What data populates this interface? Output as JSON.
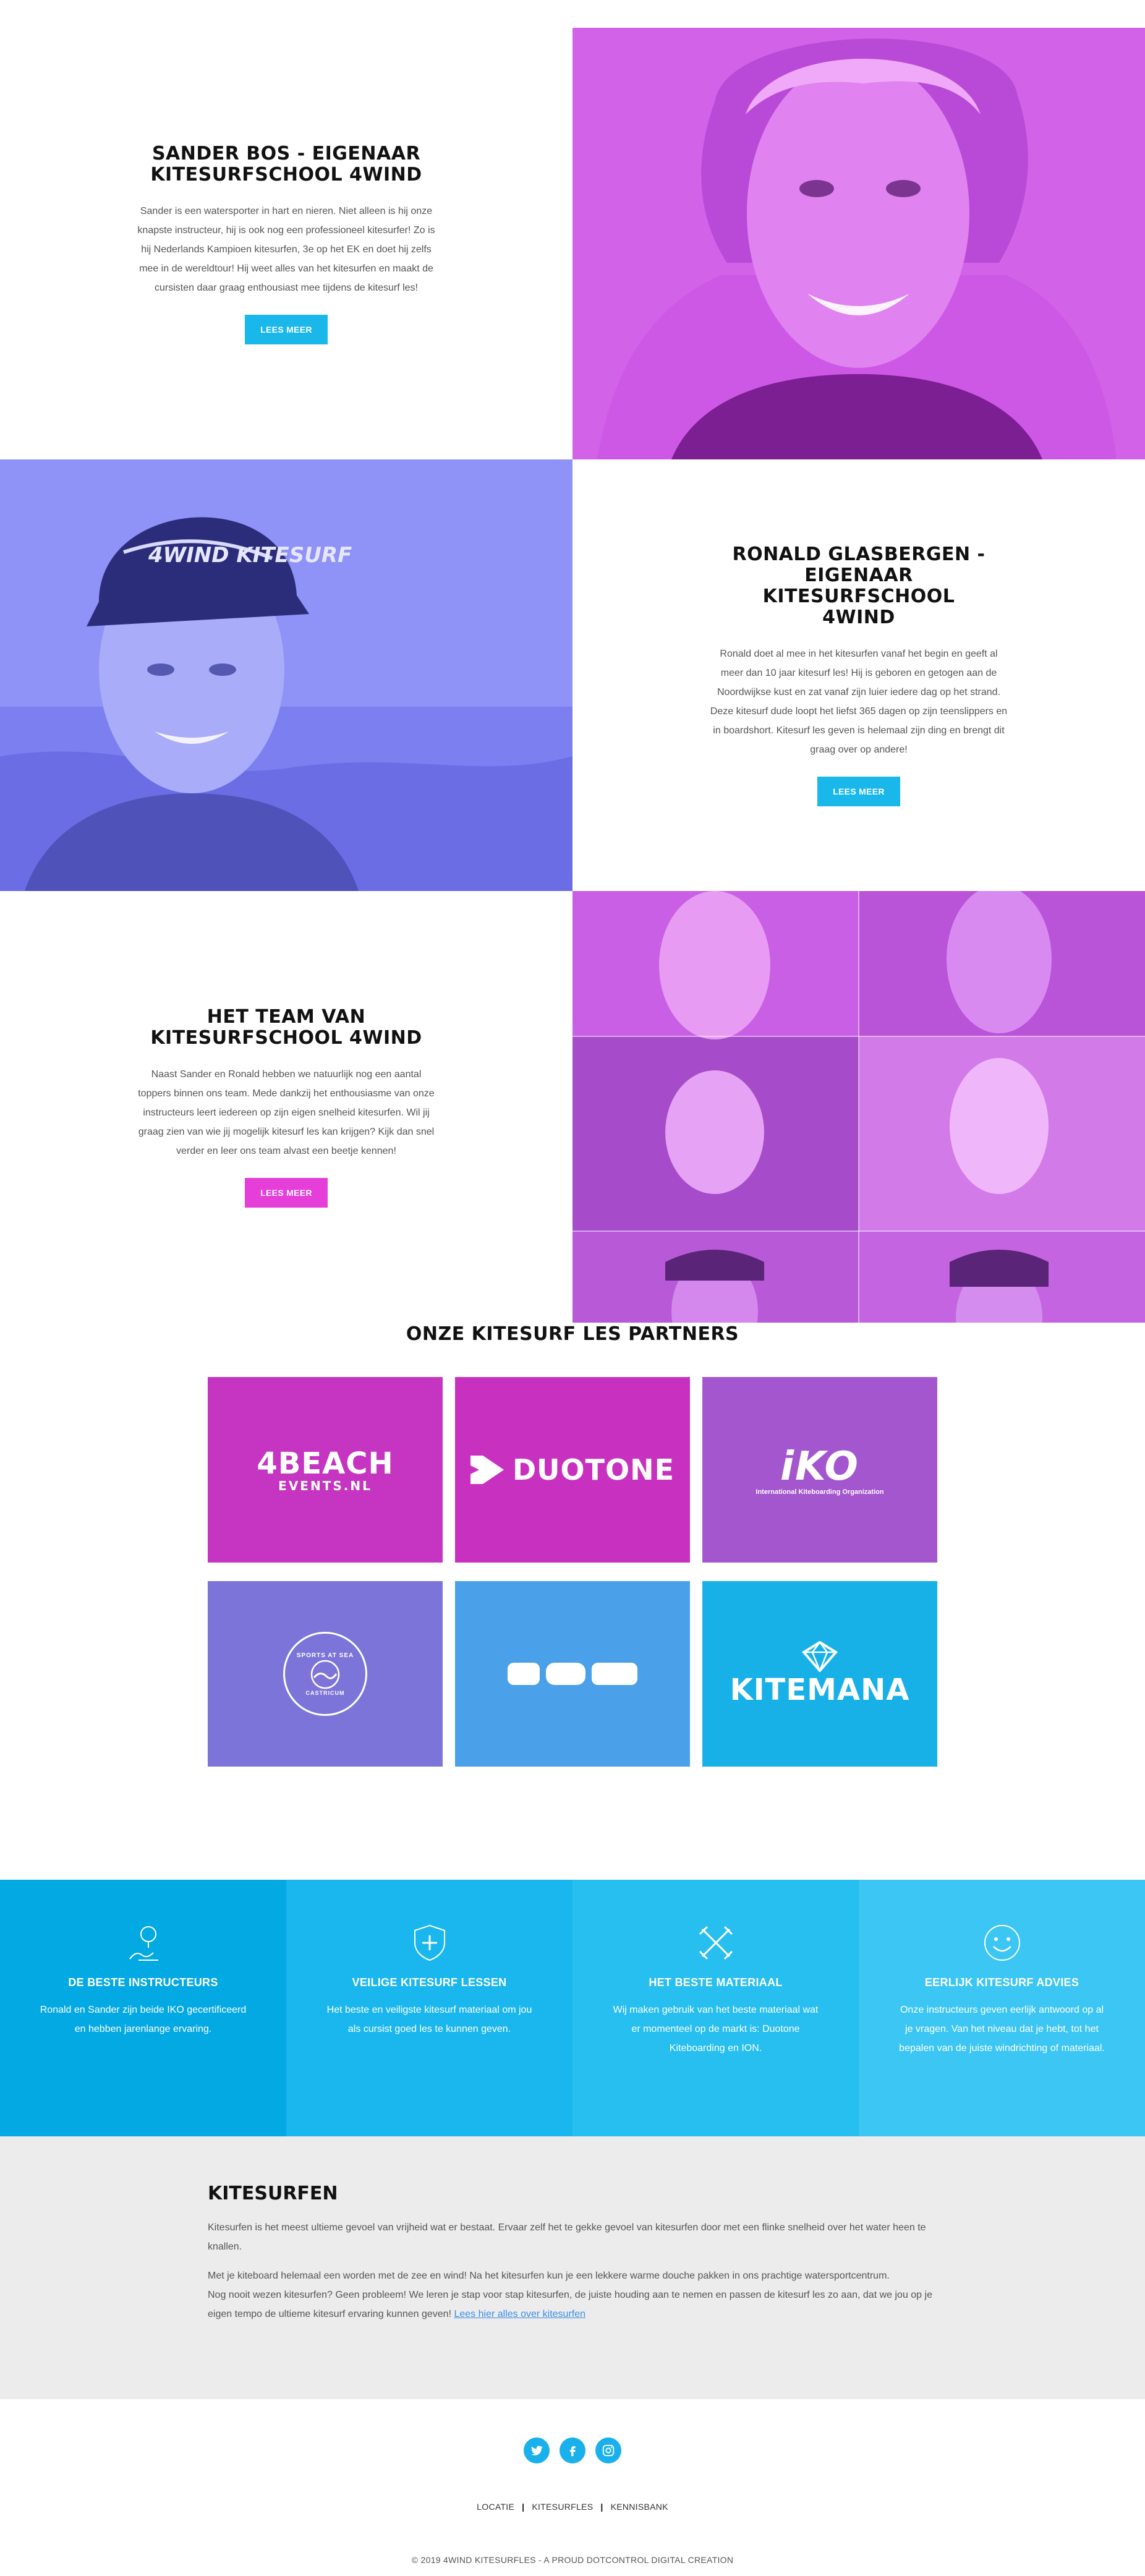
{
  "sections": [
    {
      "title_line1": "SANDER BOS - EIGENAAR",
      "title_line2": "KITESURFSCHOOL 4WIND",
      "body": "Sander is een watersporter in hart en nieren. Niet alleen is hij onze knapste instructeur, hij is ook nog een professioneel kitesurfer! Zo is hij Nederlands Kampioen kitesurfen, 3e op het EK en doet hij zelfs mee in de wereldtour! Hij weet alles van het kitesurfen en maakt de cursisten daar graag enthousiast mee tijdens de kitesurf les!",
      "button": "LEES MEER",
      "button_color": "#1ab7ea",
      "photo_tint": "#cf5ae6"
    },
    {
      "title_line1": "RONALD GLASBERGEN -",
      "title_line2": "EIGENAAR KITESURFSCHOOL",
      "title_line3": "4WIND",
      "body": "Ronald doet al mee in het kitesurfen vanaf het begin en geeft al meer dan 10 jaar kitesurf les! Hij is geboren en getogen aan de Noordwijkse kust en zat vanaf zijn luier iedere dag op het strand. Deze kitesurf dude loopt het liefst 365 dagen op zijn teenslippers en in boardshort. Kitesurf les geven is helemaal zijn ding en brengt dit graag over op andere!",
      "button": "LEES MEER",
      "button_color": "#1ab7ea",
      "photo_tint": "#8486f3",
      "cap_text": "4WIND KITESURF"
    },
    {
      "title_line1": "HET TEAM VAN",
      "title_line2": "KITESURFSCHOOL 4WIND",
      "body": "Naast Sander en Ronald hebben we natuurlijk nog een aantal toppers binnen ons team. Mede dankzij het enthousiasme van onze instructeurs leert iedereen op zijn eigen snelheid kitesurfen. Wil jij graag zien van wie jij mogelijk kitesurf les kan krijgen? Kijk dan snel verder en leer ons team alvast een beetje kennen!",
      "button": "LEES MEER",
      "button_color": "#e63ed9",
      "photo_tint": "#c15ce0"
    }
  ],
  "partners": {
    "title": "ONZE KITESURF LES PARTNERS",
    "logos": [
      {
        "name": "4BEACH",
        "sub": "EVENTS.NL",
        "color": "#c634c2"
      },
      {
        "name": "DUOTONE",
        "color": "#c831bf"
      },
      {
        "name": "iKO",
        "sub": "International Kiteboarding Organization",
        "color": "#a356cd"
      },
      {
        "name": "SPORTS AT SEA",
        "sub": "CASTRICUM",
        "color": "#7d74d9"
      },
      {
        "name": "ION",
        "color": "#4aa0e9"
      },
      {
        "name": "KITEMANA",
        "color": "#17b1e8"
      }
    ]
  },
  "features": [
    {
      "title": "DE BESTE INSTRUCTEURS",
      "body": "Ronald en Sander zijn beide IKO gecertificeerd en hebben jarenlange ervaring.",
      "icon": "trophy-icon",
      "color": "#03a9e3"
    },
    {
      "title": "VEILIGE KITESURF LESSEN",
      "body": "Het beste en veiligste kitesurf materiaal om jou als cursist goed les te kunnen geven.",
      "icon": "shield-plus-icon",
      "color": "#1ab7ee"
    },
    {
      "title": "HET BESTE MATERIAAL",
      "body": "Wij maken gebruik van het beste materiaal wat er momenteel op de markt is: Duotone Kiteboarding en ION.",
      "icon": "tools-icon",
      "color": "#27bef0"
    },
    {
      "title": "EERLIJK KITESURF ADVIES",
      "body": "Onze instructeurs geven eerlijk antwoord op al je vragen. Van het niveau dat je hebt, tot het bepalen van de juiste windrichting of materiaal.",
      "icon": "smiley-icon",
      "color": "#3cc6f4"
    }
  ],
  "kitesurfen": {
    "title": "KITESURFEN",
    "p1": "Kitesurfen is het meest ultieme gevoel van vrijheid wat er bestaat. Ervaar zelf het te gekke gevoel van kitesurfen door met een flinke snelheid over het water heen te knallen.",
    "p2": "Met je kiteboard helemaal een worden met de zee en wind! Na het kitesurfen kun je een lekkere warme douche pakken in ons prachtige watersportcentrum.",
    "p3": "Nog nooit wezen kitesurfen? Geen probleem! We leren je stap voor stap kitesurfen, de juiste houding aan te nemen en passen de kitesurf les zo aan, dat we jou op je eigen tempo de ultieme kitesurf ervaring kunnen geven!",
    "link": "Lees hier alles over kitesurfen"
  },
  "footer": {
    "nav": [
      "LOCATIE",
      "KITESURFLES",
      "KENNISBANK"
    ],
    "separator": "|",
    "copyright": "© 2019 4WIND KITESURFLES - A PROUD DOTCONTROL DIGITAL CREATION",
    "social_color": "#1ab0ec"
  }
}
